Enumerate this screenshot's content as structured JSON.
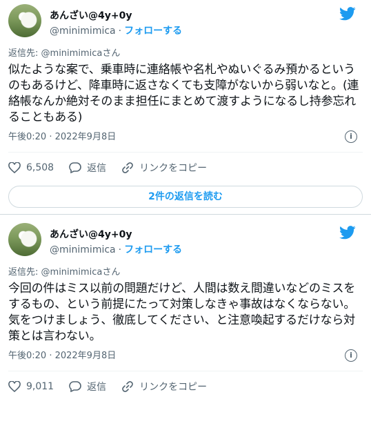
{
  "tweets": [
    {
      "display_name": "あんざい@4y+0y",
      "handle": "@minimimica",
      "dot": "·",
      "follow_label": "フォローする",
      "reply_prefix": "返信先:",
      "reply_to": "@minimimicaさん",
      "text": "似たような案で、乗車時に連絡帳や名札やぬいぐるみ預かるというのもあるけど、降車時に返さなくても支障がないから弱いなと。(連絡帳なんか絶対そのまま担任にまとめて渡すようになるし持参忘れることもある)",
      "timestamp": "午後0:20 · 2022年9月8日",
      "likes": "6,508",
      "reply_label": "返信",
      "copy_link_label": "リンクをコピー",
      "read_replies_label": "2件の返信を読む"
    },
    {
      "display_name": "あんざい@4y+0y",
      "handle": "@minimimica",
      "dot": "·",
      "follow_label": "フォローする",
      "reply_prefix": "返信先:",
      "reply_to": "@minimimicaさん",
      "text": "今回の件はミス以前の問題だけど、人間は数え間違いなどのミスをするもの、という前提にたって対策しなきゃ事故はなくならない。\n気をつけましょう、徹底してください、と注意喚起するだけなら対策とは言わない。",
      "timestamp": "午後0:20 · 2022年9月8日",
      "likes": "9,011",
      "reply_label": "返信",
      "copy_link_label": "リンクをコピー"
    }
  ],
  "colors": {
    "accent": "#1d9bf0",
    "secondary": "#536471",
    "border": "#cfd9de"
  },
  "icons": [
    "twitter-bird-icon",
    "info-icon",
    "heart-icon",
    "reply-bubble-icon",
    "link-icon"
  ]
}
